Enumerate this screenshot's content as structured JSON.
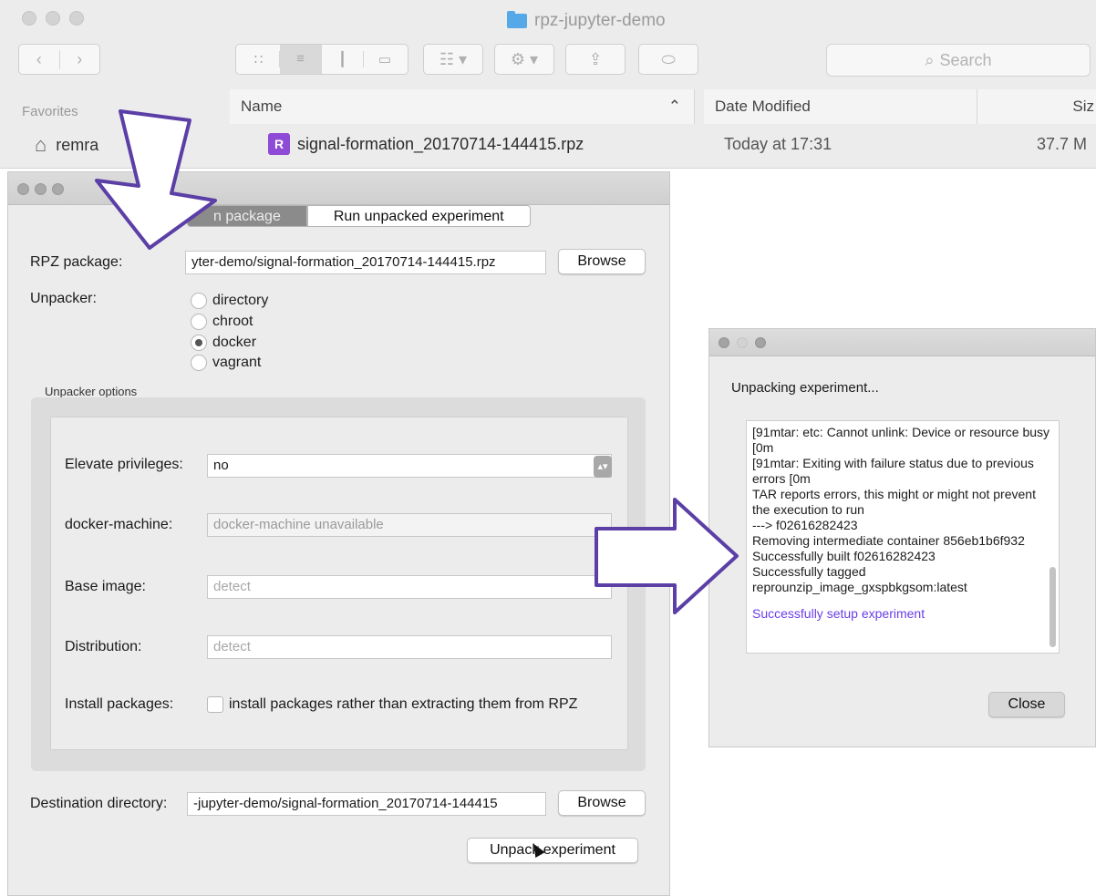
{
  "finder": {
    "title": "rpz-jupyter-demo",
    "search_placeholder": "Search",
    "sidebar_header": "Favorites",
    "sidebar_item": "remra",
    "columns": {
      "name": "Name",
      "date": "Date Modified",
      "size": "Siz"
    },
    "file": {
      "icon_letter": "R",
      "name": "signal-formation_20170714-144415.rpz",
      "date": "Today at 17:31",
      "size": "37.7 M"
    }
  },
  "unpack_dialog": {
    "tabs": [
      "n package",
      "Run unpacked experiment"
    ],
    "rpz_label": "RPZ package:",
    "rpz_value": "yter-demo/signal-formation_20170714-144415.rpz",
    "browse_label": "Browse",
    "unpacker_label": "Unpacker:",
    "unpackers": [
      {
        "label": "directory",
        "selected": false
      },
      {
        "label": "chroot",
        "selected": false
      },
      {
        "label": "docker",
        "selected": true
      },
      {
        "label": "vagrant",
        "selected": false
      }
    ],
    "options_group_label": "Unpacker options",
    "elevate_label": "Elevate privileges:",
    "elevate_value": "no",
    "docker_machine_label": "docker-machine:",
    "docker_machine_value": "docker-machine unavailable",
    "base_image_label": "Base image:",
    "base_image_placeholder": "detect",
    "distribution_label": "Distribution:",
    "distribution_placeholder": "detect",
    "install_label": "Install packages:",
    "install_checkbox_label": "install packages rather than extracting them from RPZ",
    "dest_label": "Destination directory:",
    "dest_value": "-jupyter-demo/signal-formation_20170714-144415",
    "unpack_button": "Unpack experiment"
  },
  "progress_dialog": {
    "heading": "Unpacking experiment...",
    "log_lines": [
      "[91mtar: etc: Cannot unlink: Device or resource busy [0m",
      "[91mtar: Exiting with failure status due to previous errors [0m",
      "TAR reports errors, this might or might not prevent the execution to run",
      "---> f02616282423",
      "Removing intermediate container 856eb1b6f932",
      "Successfully built f02616282423",
      "Successfully tagged reprounzip_image_gxspbkgsom:latest"
    ],
    "success_line": "Successfully setup experiment",
    "close_button": "Close"
  },
  "colors": {
    "arrow_stroke": "#5b3fa6",
    "success_text": "#6a3ee8",
    "rpz_icon": "#8e4bd6"
  }
}
